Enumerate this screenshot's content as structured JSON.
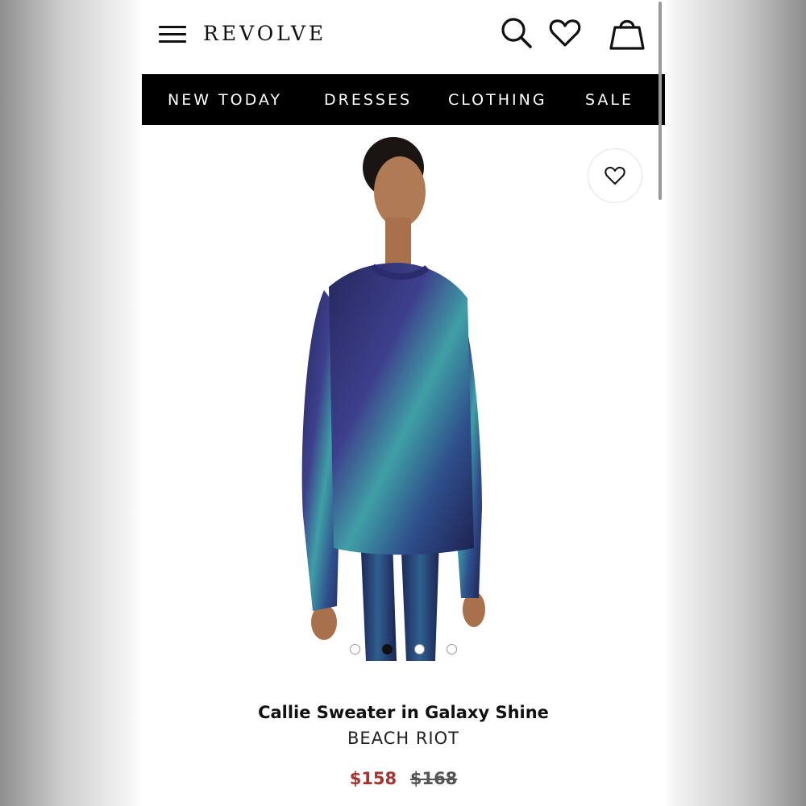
{
  "header": {
    "logo": "REVOLVE",
    "icons": [
      "menu-icon",
      "search-icon",
      "heart-icon",
      "bag-icon"
    ]
  },
  "nav": {
    "items": [
      "NEW TODAY",
      "DRESSES",
      "CLOTHING",
      "SALE"
    ]
  },
  "product": {
    "image_icon": "product-photo",
    "wishlist_icon": "heart-icon",
    "carousel": {
      "count": 4,
      "active": 2
    },
    "title": "Callie Sweater in Galaxy Shine",
    "brand": "BEACH RIOT",
    "sale_price": "$158",
    "original_price": "$168"
  },
  "colors": {
    "sale_price": "#a8322f",
    "navbar_bg": "#000000",
    "sweater_blue": "#2a3a7a",
    "sweater_teal": "#3fa3a8"
  }
}
